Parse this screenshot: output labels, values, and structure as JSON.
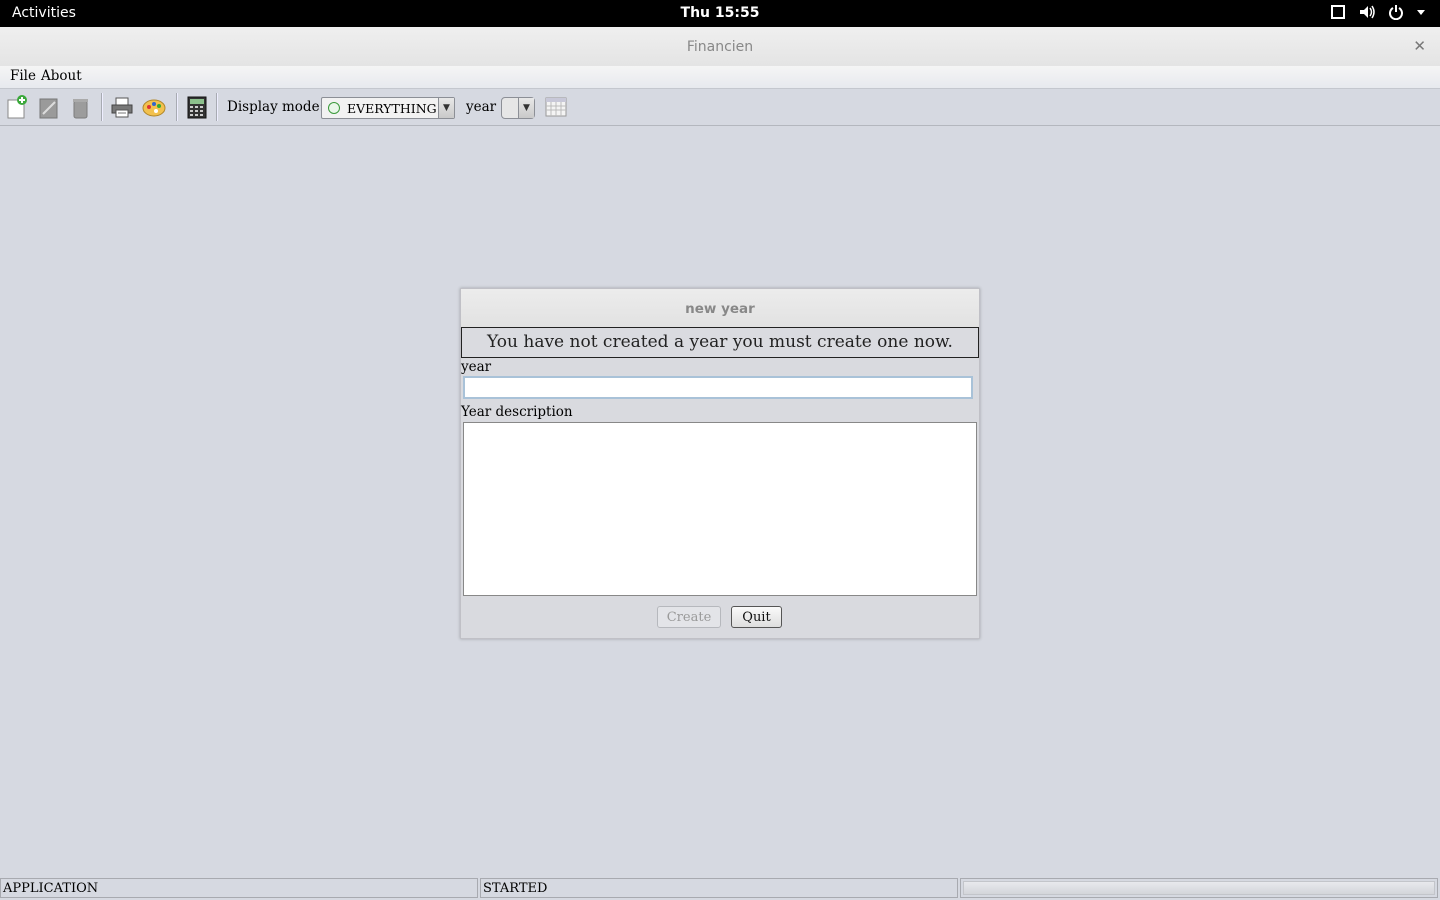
{
  "topbar": {
    "activities": "Activities",
    "clock": "Thu 15:55"
  },
  "window": {
    "title": "Financien"
  },
  "menubar": {
    "file": "File",
    "about": "About"
  },
  "toolbar": {
    "display_mode_label": "Display mode:",
    "display_mode_value": "EVERYTHING",
    "year_label": "year",
    "year_value": ""
  },
  "dialog": {
    "title": "new year",
    "message": "You have not created a year you must create one now.",
    "year_label": "year",
    "year_value": "",
    "description_label": "Year description",
    "description_value": "",
    "create_label": "Create",
    "create_enabled": false,
    "quit_label": "Quit"
  },
  "statusbar": {
    "left": "APPLICATION",
    "middle": "STARTED",
    "progress": 0
  }
}
